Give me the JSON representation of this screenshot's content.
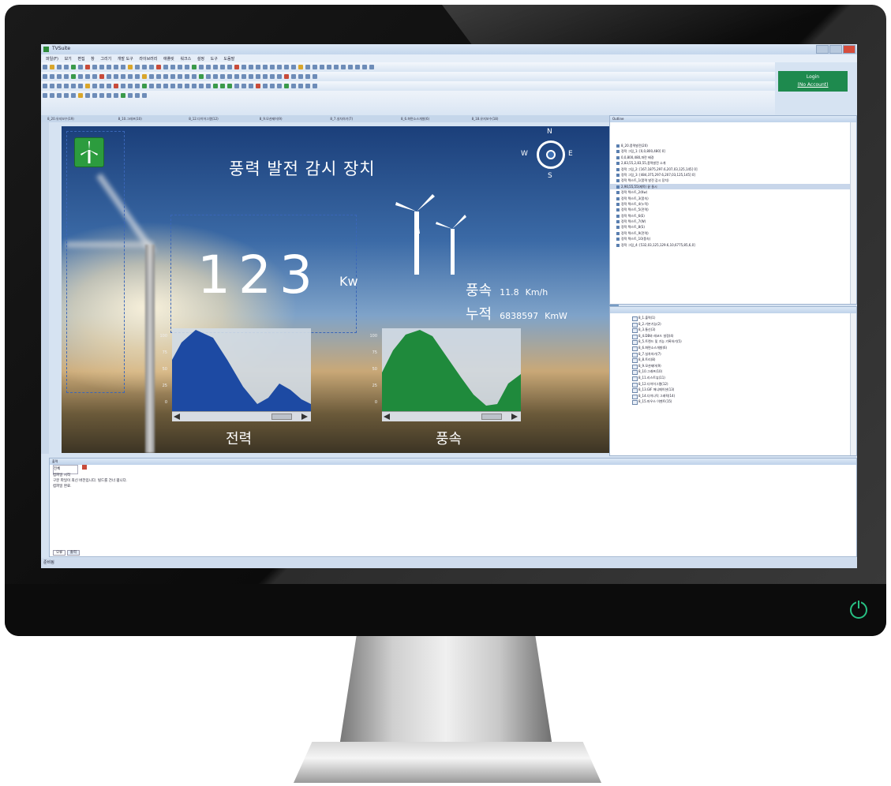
{
  "app": {
    "window_title": "TVSuite",
    "menu": [
      "파일(F)",
      "보기",
      "편집",
      "창",
      "그리기",
      "개발 도구",
      "라이브러리",
      "애플릿",
      "워크스",
      "설정",
      "도구",
      "도움말"
    ],
    "login_label": "Login",
    "login_sub": "(No Account)",
    "status_text": "준비됨",
    "colors": {
      "accent": "#1e8a4e",
      "canvas_top": "#1b3f7a",
      "power_led": "#27c083"
    }
  },
  "doc_tabs": [
    "8_20.유지보수(19)",
    "8_10.그래프(10)",
    "8_12.다이어그램(12)",
    "8_9.모션제어(9)",
    "8_7.실차하기(7)",
    "8_6.화면소스개발(6)",
    "8_18.유지보수(18)"
  ],
  "canvas": {
    "title": "풍력 발전 감시 장치",
    "power_value": "123",
    "power_unit": "Kw",
    "compass": {
      "n": "N",
      "s": "S",
      "e": "E",
      "w": "W"
    },
    "wind_speed": {
      "label": "풍속",
      "value": "11.8",
      "unit": "Km/h"
    },
    "cumulative": {
      "label": "누적",
      "value": "6838597",
      "unit": "KmW"
    },
    "charts": [
      {
        "label": "전력",
        "ticks": [
          "100",
          "75",
          "50",
          "25",
          "0"
        ]
      },
      {
        "label": "풍속",
        "ticks": [
          "100",
          "75",
          "50",
          "25",
          "0"
        ]
      }
    ],
    "icons": [
      "wind-turbine-logo-icon",
      "compass-icon",
      "wind-turbine-icon"
    ]
  },
  "outline": {
    "title": "Outline",
    "items": [
      "8_20.풍력발전(20)",
      "정적 그림_1: [0,0,800,480] 0]",
      "0,0,800,480,파란 배경",
      "2,83,55,2,83,55,풍력발전 소개",
      "정적 그림_2: [167,1875,297.6,207,03,125,145] 0]",
      "정적 그림_3: [484,375,297.6,207,03,125,145] 0]",
      "정적 텍스트_1(풍력 발전 감시 장치)",
      "2,90,55,55(제목) 끝 들시",
      "정적 텍스트_2(Kw)",
      "정적 텍스트_3(풍속)",
      "정적 텍스트_4(누적)",
      "정적 텍스트_5(전력)",
      "정적 텍스트_6(E)",
      "정적 텍스트_7(W)",
      "정적 텍스트_8(S)",
      "정적 텍스트_9(전력)",
      "정적 텍스트_10(풍속)",
      "정적 그림_4: [532,03,125,129.6,10,6775,85,6,0]"
    ]
  },
  "library": {
    "items": [
      "8_1.출력(1)",
      "8_2.기본기능(2)",
      "8_3.통신(3)",
      "8_4.DB와 레코드 설정(4)",
      "8_5.트렌드 및 기능 기록하기(5)",
      "8_6.화면소스개발(6)",
      "8_7.실차하기(7)",
      "8_8.트리(8)",
      "8_9.모션제어(9)",
      "8_10.그래프(10)",
      "8_11.리스트뷰(11)",
      "8_12.다이어그램(12)",
      "8_13.GIF 애니메이션(13)",
      "8_14.다이나믹 그래픽(14)",
      "8_15.마우스 이벤트(15)"
    ]
  },
  "output": {
    "title": "출력",
    "filter": "전체",
    "lines": [
      "컴파일 시작",
      "구분 파일이 최신 버전입니다. 빌드를 건너 뜁니다.",
      "컴파일 완료."
    ],
    "tabs": [
      "오류",
      "출력"
    ]
  }
}
